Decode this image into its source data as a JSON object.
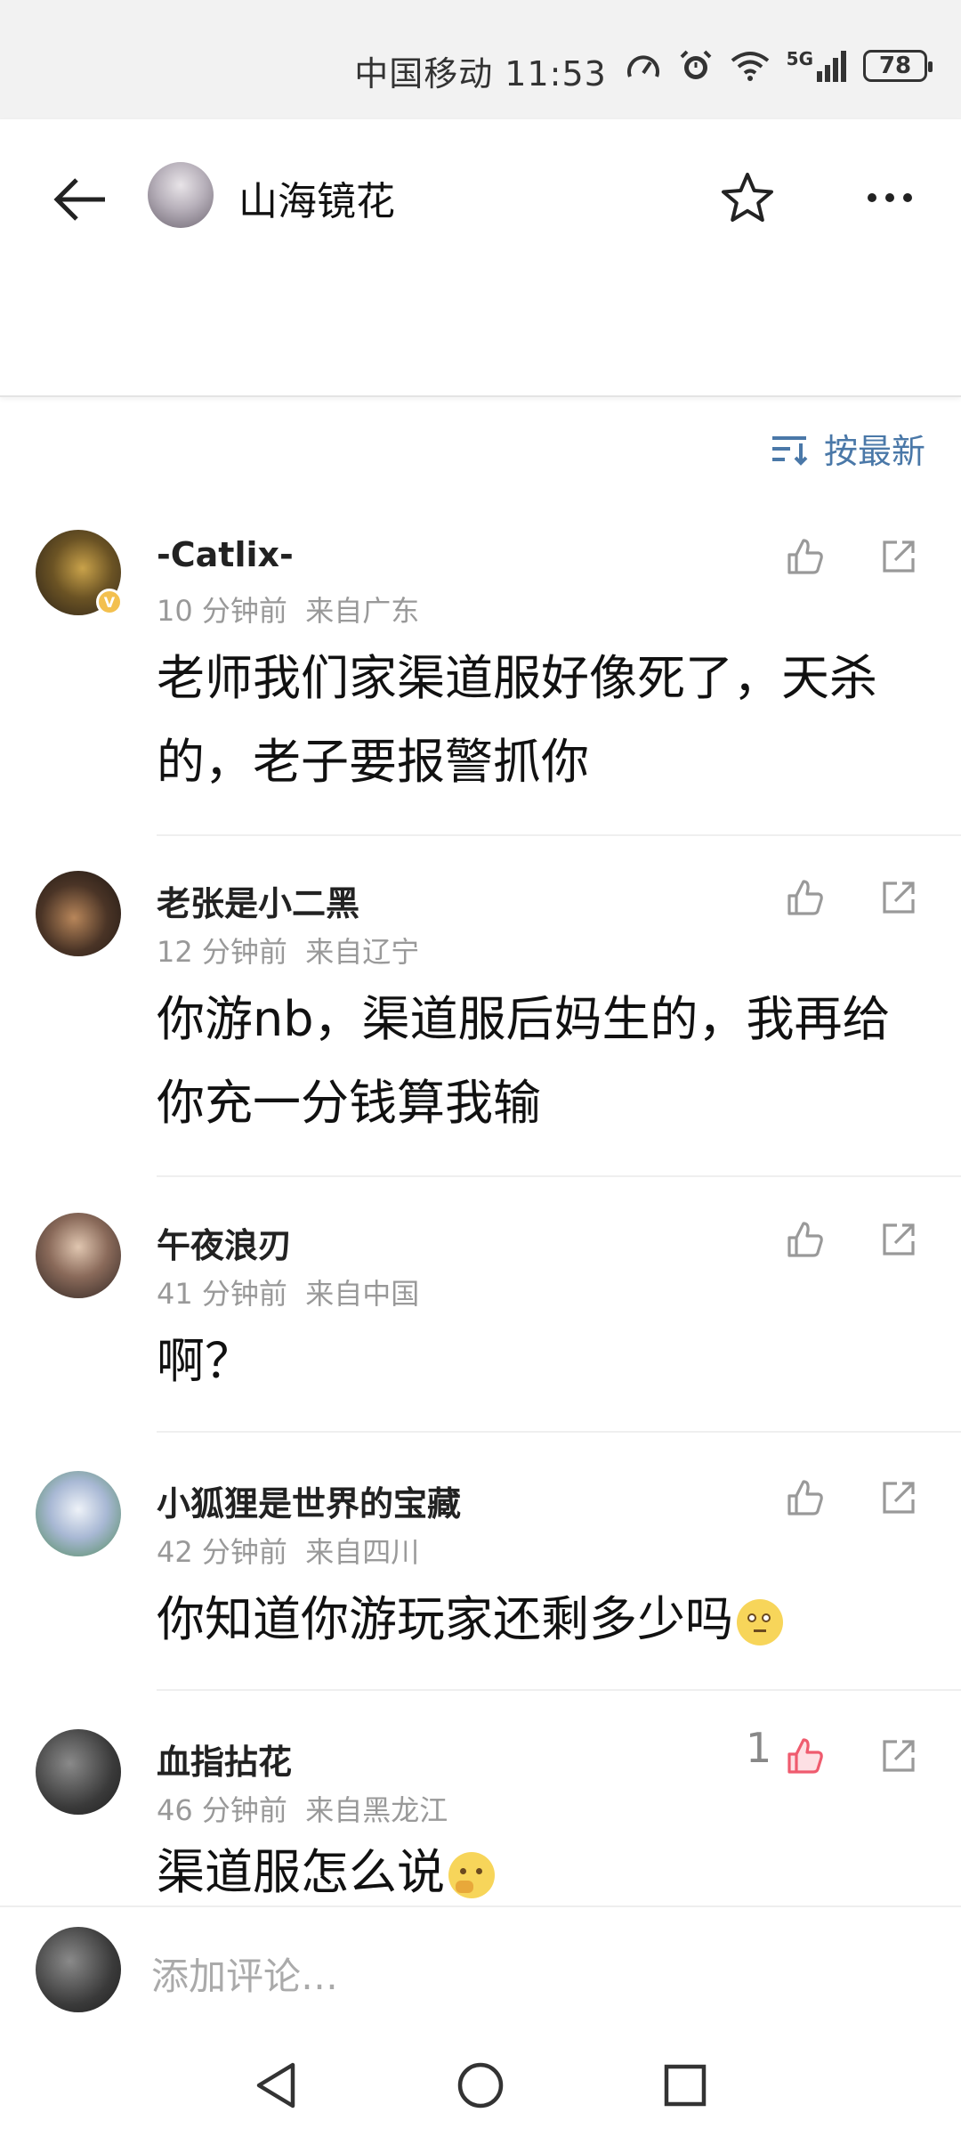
{
  "status_bar": {
    "carrier_time": "中国移动 11:53",
    "network": "5G",
    "battery": "78"
  },
  "header": {
    "title": "山海镜花"
  },
  "sort": {
    "label": "按最新"
  },
  "comments": [
    {
      "name": "-Catlix-",
      "time": "10 分钟前",
      "location": "来自广东",
      "text": "老师我们家渠道服好像死了，天杀的，老子要报警抓你"
    },
    {
      "name": "老张是小二黑",
      "time": "12 分钟前",
      "location": "来自辽宁",
      "text": "你游nb，渠道服后妈生的，我再给你充一分钱算我输"
    },
    {
      "name": "午夜浪刃",
      "time": "41 分钟前",
      "location": "来自中国",
      "text": "啊？"
    },
    {
      "name": "小狐狸是世界的宝藏",
      "time": "42 分钟前",
      "location": "来自四川",
      "text": "你知道你游玩家还剩多少吗"
    },
    {
      "name": "血指拈花",
      "time": "46 分钟前",
      "location": "来自黑龙江",
      "text": "渠道服怎么说",
      "likes": "1"
    }
  ],
  "input": {
    "placeholder": "添加评论…"
  },
  "colors": {
    "accent": "#4a78a8",
    "liked": "#ef5b6e"
  }
}
